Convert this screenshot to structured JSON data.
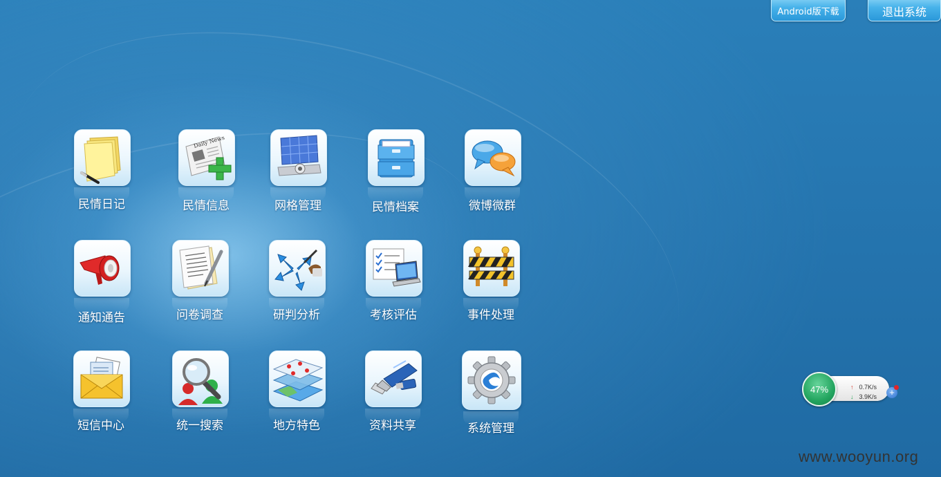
{
  "header": {
    "android_download": "Android版下载",
    "logout": "退出系统"
  },
  "tiles": [
    {
      "label": "民情日记",
      "icon": "sticky-notes-icon"
    },
    {
      "label": "民情信息",
      "icon": "newspaper-add-icon"
    },
    {
      "label": "网格管理",
      "icon": "grid-monitor-icon"
    },
    {
      "label": "民情档案",
      "icon": "file-cabinet-icon"
    },
    {
      "label": "微博微群",
      "icon": "chat-bubbles-icon"
    },
    {
      "label": "通知通告",
      "icon": "megaphone-icon"
    },
    {
      "label": "问卷调查",
      "icon": "questionnaire-pen-icon"
    },
    {
      "label": "研判分析",
      "icon": "analysis-arrows-icon"
    },
    {
      "label": "考核评估",
      "icon": "laptop-checklist-icon"
    },
    {
      "label": "事件处理",
      "icon": "construction-barrier-icon"
    },
    {
      "label": "短信中心",
      "icon": "envelope-icon"
    },
    {
      "label": "统一搜索",
      "icon": "search-users-icon"
    },
    {
      "label": "地方特色",
      "icon": "map-layers-icon"
    },
    {
      "label": "资料共享",
      "icon": "usb-drive-icon"
    },
    {
      "label": "系统管理",
      "icon": "gear-icon"
    }
  ],
  "network_widget": {
    "percent": "47%",
    "upload": "0.7K/s",
    "download": "3.9K/s",
    "upload_arrow": "↑",
    "download_arrow": "↓",
    "plus": "+"
  },
  "watermark": "www.wooyun.org",
  "colors": {
    "background": "#2473ad",
    "button": "#47b2ea",
    "widget_green": "#23a55f"
  }
}
